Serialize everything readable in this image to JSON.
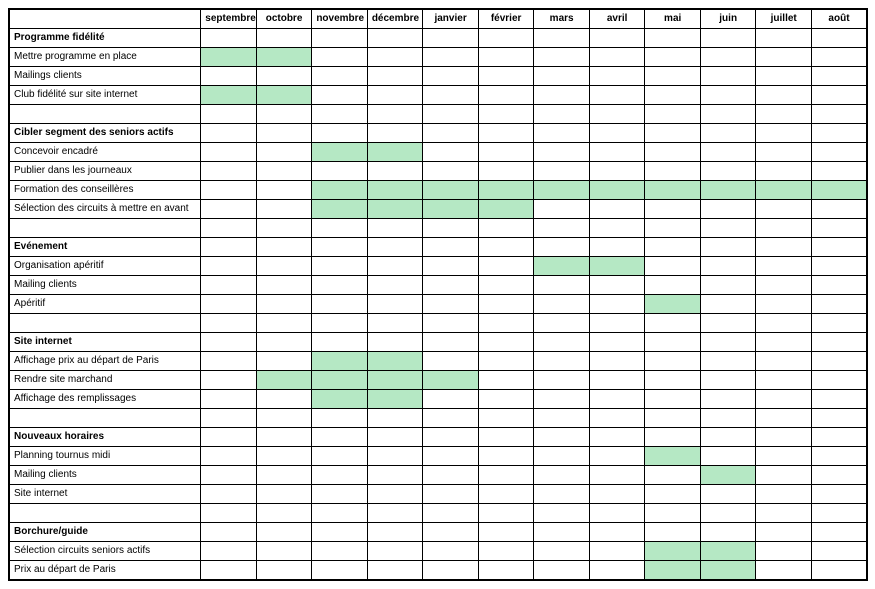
{
  "months": [
    "septembre",
    "octobre",
    "novembre",
    "décembre",
    "janvier",
    "février",
    "mars",
    "avril",
    "mai",
    "juin",
    "juillet",
    "août"
  ],
  "colors": {
    "fill": "#b5e8c4"
  },
  "sections": [
    {
      "title": "Programme fidélité",
      "rows": [
        {
          "label": "Mettre programme en place",
          "fill": [
            0,
            1
          ]
        },
        {
          "label": "Mailings clients",
          "fill": []
        },
        {
          "label": "Club fidélité sur site internet",
          "fill": [
            0,
            1
          ]
        }
      ]
    },
    {
      "title": "Cibler segment des seniors actifs",
      "rows": [
        {
          "label": "Concevoir encadré",
          "fill": [
            2,
            3
          ]
        },
        {
          "label": "Publier dans les journeaux",
          "fill": []
        },
        {
          "label": "Formation des conseillères",
          "fill": [
            2,
            3,
            4,
            5,
            6,
            7,
            8,
            9,
            10,
            11
          ]
        },
        {
          "label": "Sélection des circuits à mettre en avant",
          "fill": [
            2,
            3,
            4,
            5
          ]
        }
      ]
    },
    {
      "title": "Evénement",
      "rows": [
        {
          "label": "Organisation apéritif",
          "fill": [
            6,
            7
          ]
        },
        {
          "label": "Mailing clients",
          "fill": []
        },
        {
          "label": "Apéritif",
          "fill": [
            8
          ]
        }
      ]
    },
    {
      "title": "Site internet",
      "rows": [
        {
          "label": "Affichage prix au départ de Paris",
          "fill": [
            2,
            3
          ]
        },
        {
          "label": "Rendre site marchand",
          "fill": [
            1,
            2,
            3,
            4
          ]
        },
        {
          "label": "Affichage des remplissages",
          "fill": [
            2,
            3
          ]
        }
      ]
    },
    {
      "title": "Nouveaux horaires",
      "rows": [
        {
          "label": "Planning tournus midi",
          "fill": [
            8
          ]
        },
        {
          "label": "Mailing clients",
          "fill": [
            9
          ]
        },
        {
          "label": "Site internet",
          "fill": []
        }
      ]
    },
    {
      "title": "Borchure/guide",
      "rows": [
        {
          "label": "Sélection circuits seniors actifs",
          "fill": [
            8,
            9
          ]
        },
        {
          "label": "Prix au départ de Paris",
          "fill": [
            8,
            9
          ]
        }
      ]
    }
  ]
}
